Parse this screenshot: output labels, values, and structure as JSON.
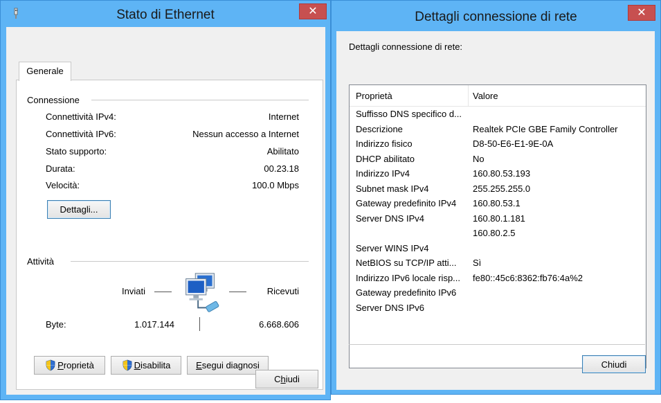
{
  "ethernet_status": {
    "title": "Stato di Ethernet",
    "close_glyph": "✕",
    "tab_label": "Generale",
    "connection_group": "Connessione",
    "connection_rows": [
      {
        "label": "Connettività IPv4:",
        "value": "Internet"
      },
      {
        "label": "Connettività IPv6:",
        "value": "Nessun accesso a Internet"
      },
      {
        "label": "Stato supporto:",
        "value": "Abilitato"
      },
      {
        "label": "Durata:",
        "value": "00.23.18"
      },
      {
        "label": "Velocità:",
        "value": "100.0 Mbps"
      }
    ],
    "details_button": {
      "prefix": "Detta",
      "accel": "g",
      "suffix": "li..."
    },
    "activity_group": "Attività",
    "sent_label": "Inviati",
    "received_label": "Ricevuti",
    "bytes_label": "Byte:",
    "bytes_sent": "1.017.144",
    "bytes_received": "6.668.606",
    "properties_button": {
      "accel": "P",
      "rest": "roprietà"
    },
    "disable_button": {
      "accel": "D",
      "rest": "isabilita"
    },
    "diagnose_button": {
      "accel": "E",
      "rest": "segui diagnosi"
    },
    "close_button": {
      "prefix": "C",
      "accel": "h",
      "suffix": "iudi"
    }
  },
  "network_details": {
    "title": "Dettagli connessione di rete",
    "close_glyph": "✕",
    "list_caption": "Dettagli connessione di rete:",
    "columns": {
      "property": "Proprietà",
      "value": "Valore"
    },
    "rows": [
      {
        "property": "Suffisso DNS specifico d...",
        "value": ""
      },
      {
        "property": "Descrizione",
        "value": "Realtek PCIe GBE Family Controller"
      },
      {
        "property": "Indirizzo fisico",
        "value": "D8-50-E6-E1-9E-0A"
      },
      {
        "property": "DHCP abilitato",
        "value": "No"
      },
      {
        "property": "Indirizzo IPv4",
        "value": "160.80.53.193"
      },
      {
        "property": "Subnet mask IPv4",
        "value": "255.255.255.0"
      },
      {
        "property": "Gateway predefinito IPv4",
        "value": "160.80.53.1"
      },
      {
        "property": "Server DNS IPv4",
        "value": "160.80.1.181"
      },
      {
        "property": "",
        "value": "160.80.2.5"
      },
      {
        "property": "Server WINS IPv4",
        "value": ""
      },
      {
        "property": "NetBIOS su TCP/IP atti...",
        "value": "Sì"
      },
      {
        "property": "Indirizzo IPv6 locale risp...",
        "value": "fe80::45c6:8362:fb76:4a%2"
      },
      {
        "property": "Gateway predefinito IPv6",
        "value": ""
      },
      {
        "property": "Server DNS IPv6",
        "value": ""
      }
    ],
    "close_button": "Chiudi"
  },
  "colors": {
    "frame": "#5eb4f5",
    "close": "#c75050",
    "client": "#f0f0f0"
  }
}
